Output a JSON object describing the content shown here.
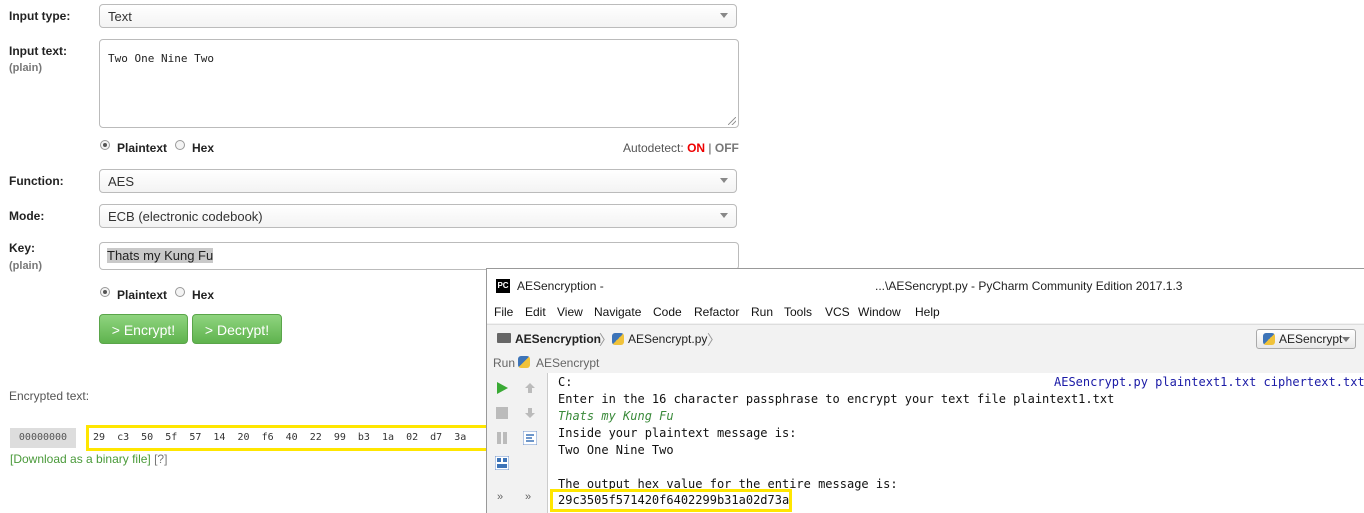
{
  "form": {
    "input_type_label": "Input type:",
    "input_type_value": "Text",
    "input_text_label": "Input text:",
    "input_text_sub": "(plain)",
    "input_text_value": "Two One Nine Two",
    "input_format": {
      "plaintext": "Plaintext",
      "hex": "Hex"
    },
    "autodetect": {
      "label": "Autodetect:",
      "on": "ON",
      "sep": "|",
      "off": "OFF"
    },
    "function_label": "Function:",
    "function_value": "AES",
    "mode_label": "Mode:",
    "mode_value": "ECB (electronic codebook)",
    "key_label": "Key:",
    "key_sub": "(plain)",
    "key_value": "Thats my Kung Fu",
    "key_format": {
      "plaintext": "Plaintext",
      "hex": "Hex"
    },
    "encrypt_button": "> Encrypt!",
    "decrypt_button": "> Decrypt!",
    "encrypted_label": "Encrypted text:",
    "hex_offset": "00000000",
    "hex_bytes": "29  c3  50  5f  57  14  20  f6  40  22  99  b3  1a  02  d7  3a",
    "download_link": "[Download as a binary file]",
    "help_link": "[?]"
  },
  "pycharm": {
    "logo": "PC",
    "title_left": "AESencryption -",
    "title_right": "...\\AESencrypt.py - PyCharm Community Edition 2017.1.3",
    "menu": [
      "File",
      "Edit",
      "View",
      "Navigate",
      "Code",
      "Refactor",
      "Run",
      "Tools",
      "VCS",
      "Window",
      "Help"
    ],
    "breadcrumb": {
      "project": "AESencryption",
      "file": "AESencrypt.py"
    },
    "run_config": "AESencrypt",
    "run_label": "Run",
    "run_tab": "AESencrypt",
    "console": {
      "cmd_left": "C:",
      "cmd_right": "AESencrypt.py plaintext1.txt ciphertext.txt",
      "line1": "Enter in the 16 character passphrase to encrypt your text file plaintext1.txt",
      "echo": "Thats my Kung Fu",
      "line3": "Inside your plaintext message is:",
      "line4": "Two One Nine Two",
      "line6": "The output hex value for the entire message is:",
      "hex_output": "29c3505f571420f6402299b31a02d73a"
    }
  }
}
